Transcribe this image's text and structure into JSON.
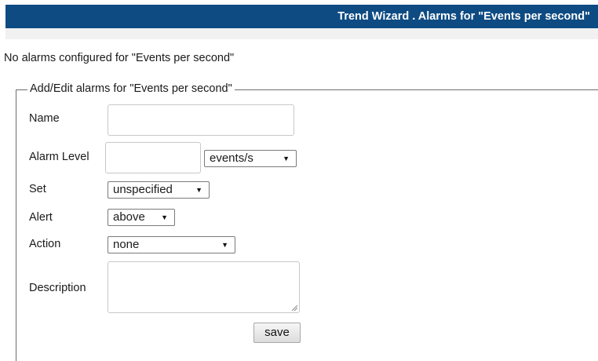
{
  "header": {
    "title": "Trend Wizard . Alarms for \"Events per second\""
  },
  "status_message": "No alarms configured for \"Events per second\"",
  "form": {
    "legend": "Add/Edit alarms for \"Events per second\"",
    "name": {
      "label": "Name",
      "value": ""
    },
    "alarm_level": {
      "label": "Alarm Level",
      "value": "",
      "unit": "events/s"
    },
    "set": {
      "label": "Set",
      "value": "unspecified"
    },
    "alert": {
      "label": "Alert",
      "value": "above"
    },
    "action": {
      "label": "Action",
      "value": "none"
    },
    "description": {
      "label": "Description",
      "value": ""
    },
    "save_label": "save"
  },
  "icons": {
    "dropdown_arrow": "triangle-down-icon",
    "resize": "resize-grip-icon"
  },
  "colors": {
    "header_bg": "#0e4b82",
    "header_text": "#ffffff"
  }
}
